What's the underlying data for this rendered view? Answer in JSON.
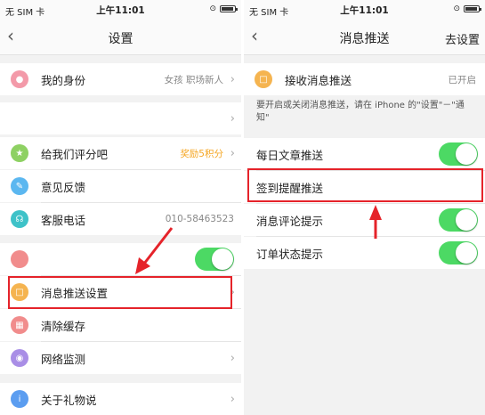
{
  "left": {
    "status": {
      "carrier": "无 SIM 卡",
      "time": "上午11:01"
    },
    "nav": {
      "back": "‹",
      "title": "设置"
    },
    "rows": {
      "identity": {
        "label": "我的身份",
        "value": "女孩 职场新人",
        "icon": "user-icon",
        "color": "#f39aa9"
      },
      "rate": {
        "label": "给我们评分吧",
        "value": "奖励5积分",
        "icon": "star-icon",
        "color": "#8ed163"
      },
      "feedback": {
        "label": "意见反馈",
        "icon": "edit-icon",
        "color": "#5bb7f0"
      },
      "phone": {
        "label": "客服电话",
        "value": "010-58463523",
        "icon": "headset-icon",
        "color": "#3ec2c8"
      },
      "push": {
        "label": "消息推送设置",
        "icon": "message-icon",
        "color": "#f5b450"
      },
      "cache": {
        "label": "清除缓存",
        "icon": "trash-icon",
        "color": "#f18c8c"
      },
      "network": {
        "label": "网络监测",
        "icon": "globe-icon",
        "color": "#a98ee6"
      },
      "about": {
        "label": "关于礼物说",
        "icon": "info-icon",
        "color": "#5b9df0"
      }
    }
  },
  "right": {
    "status": {
      "carrier": "无 SIM 卡",
      "time": "上午11:01"
    },
    "nav": {
      "back": "‹",
      "title": "消息推送",
      "action": "去设置"
    },
    "receive": {
      "label": "接收消息推送",
      "value": "已开启",
      "icon": "message-icon",
      "color": "#f5b450"
    },
    "note": "要开启或关闭消息推送，请在 iPhone 的\"设置\"－\"通知\"",
    "items": {
      "daily": {
        "label": "每日文章推送",
        "on": true
      },
      "signin": {
        "label": "签到提醒推送"
      },
      "comment": {
        "label": "消息评论提示",
        "on": true
      },
      "order": {
        "label": "订单状态提示",
        "on": true
      }
    }
  },
  "colors": {
    "highlight": "#e5232a",
    "toggle_on": "#4cd964"
  },
  "chevron": "›"
}
